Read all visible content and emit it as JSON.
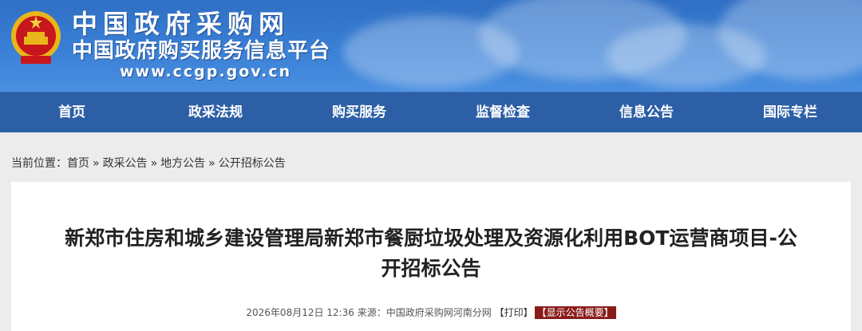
{
  "header": {
    "site_title": "中国政府采购网",
    "site_subtitle": "中国政府购买服务信息平台",
    "site_url": "www.ccgp.gov.cn"
  },
  "nav": {
    "items": [
      "首页",
      "政采法规",
      "购买服务",
      "监督检查",
      "信息公告",
      "国际专栏"
    ]
  },
  "breadcrumb": {
    "prefix": "当前位置：",
    "items": [
      "首页",
      "政采公告",
      "地方公告",
      "公开招标公告"
    ],
    "separator": "»"
  },
  "article": {
    "title_line1": "新郑市住房和城乡建设管理局新郑市餐厨垃圾处理及资源化利用BOT运营商项目-公",
    "title_line2": "开招标公告",
    "meta_datetime": "2026年08月12日 12:36",
    "meta_source_label": "来源：",
    "meta_source": "中国政府采购网河南分网",
    "print_label": "【打印】",
    "summary_label": "【显示公告概要】"
  },
  "colors": {
    "banner": "#3a80d6",
    "nav": "#2d5fa6",
    "summary_button": "#8a1b1b"
  },
  "icons": {
    "emblem": "national-emblem-icon"
  }
}
